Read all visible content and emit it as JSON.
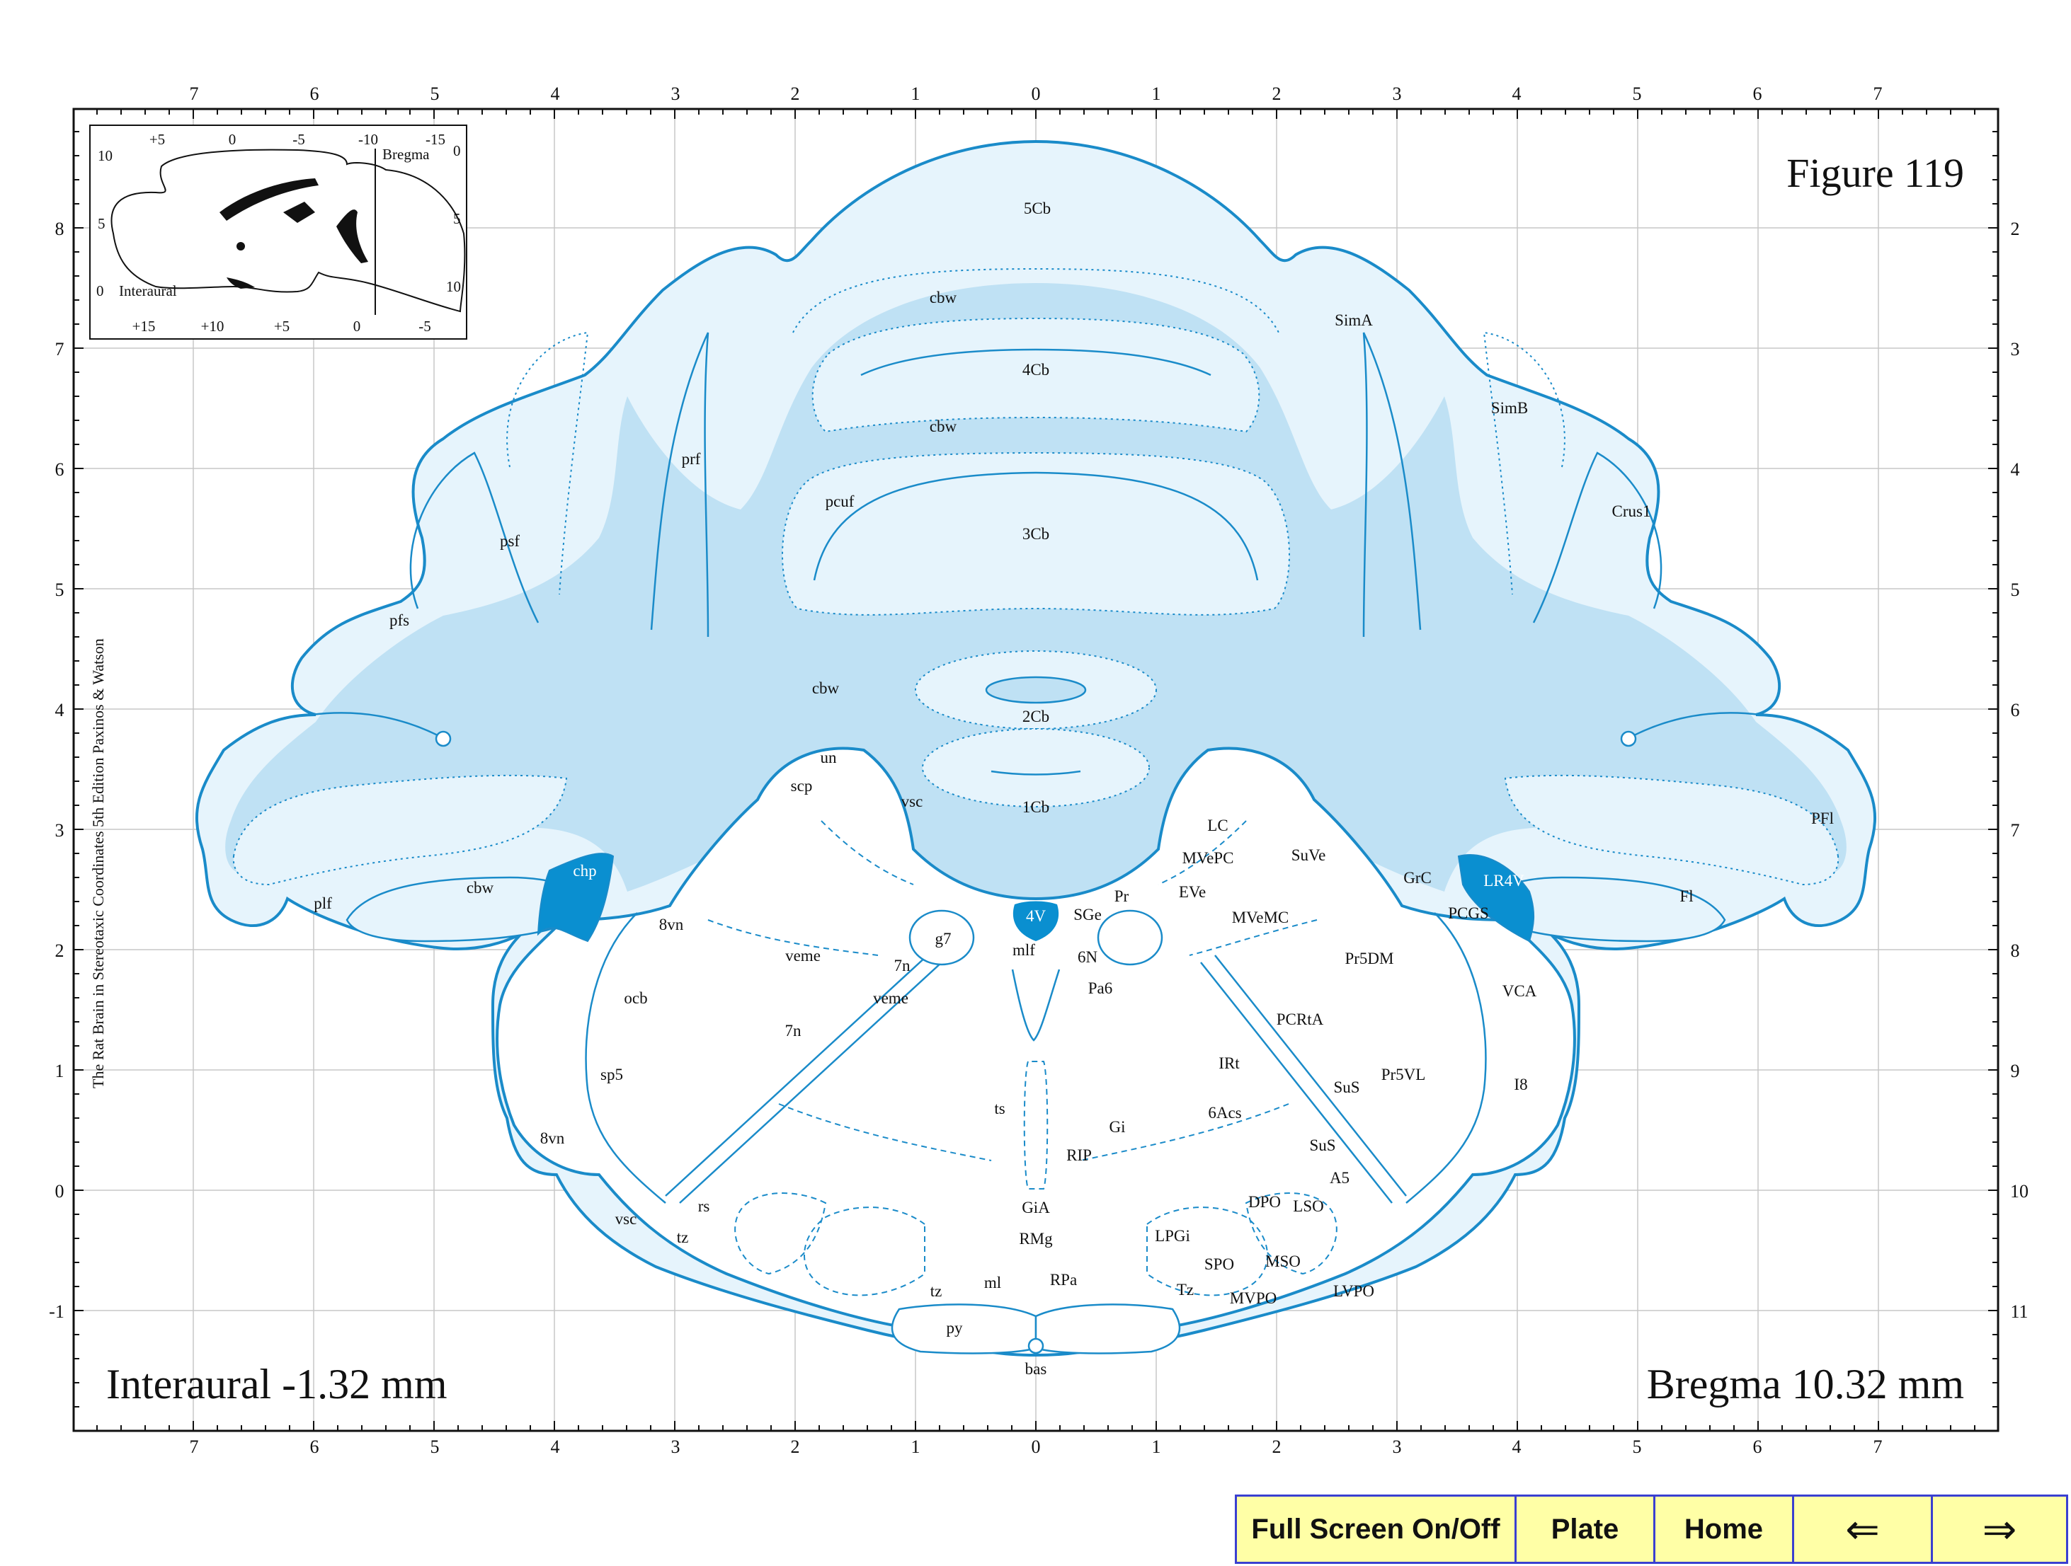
{
  "figure": {
    "title": "Figure 119",
    "interaural_caption": "Interaural -1.32 mm",
    "bregma_caption": "Bregma 10.32 mm",
    "credit": "The Rat Brain in Stereotaxic Coordinates  5th Edition  Paxinos & Watson"
  },
  "axes": {
    "top_ticks": [
      "7",
      "6",
      "5",
      "4",
      "3",
      "2",
      "1",
      "0",
      "1",
      "2",
      "3",
      "4",
      "5",
      "6",
      "7"
    ],
    "bottom_ticks": [
      "7",
      "6",
      "5",
      "4",
      "3",
      "2",
      "1",
      "0",
      "1",
      "2",
      "3",
      "4",
      "5",
      "6",
      "7"
    ],
    "left_ticks": [
      "8",
      "7",
      "6",
      "5",
      "4",
      "3",
      "2",
      "1",
      "0",
      "-1"
    ],
    "right_ticks": [
      "2",
      "3",
      "4",
      "5",
      "6",
      "7",
      "8",
      "9",
      "10",
      "11"
    ]
  },
  "inset": {
    "top_ticks": [
      "+5",
      "0",
      "-5",
      "-10",
      "-15"
    ],
    "bottom_ticks": [
      "+15",
      "+10",
      "+5",
      "0",
      "-5"
    ],
    "left_ticks": [
      "10",
      "5",
      "0"
    ],
    "right_ticks": [
      "0",
      "5",
      "10"
    ],
    "bregma_label": "Bregma",
    "interaural_label": "Interaural"
  },
  "structures": {
    "c5Cb": "5Cb",
    "cbw_top1": "cbw",
    "c4Cb": "4Cb",
    "cbw_top2": "cbw",
    "c3Cb": "3Cb",
    "c2Cb": "2Cb",
    "c1Cb": "1Cb",
    "cbw_center": "cbw",
    "cbw_left": "cbw",
    "prf": "prf",
    "pcuf": "pcuf",
    "psf": "psf",
    "pfs": "pfs",
    "plf": "plf",
    "SimA": "SimA",
    "SimB": "SimB",
    "Crus1": "Crus1",
    "PFl": "PFl",
    "Fl": "Fl",
    "chp": "chp",
    "LR4V": "LR4V",
    "GrC": "GrC",
    "PCGS": "PCGS",
    "un": "un",
    "scp": "scp",
    "vsc_top": "vsc",
    "LC": "LC",
    "MVePC": "MVePC",
    "SuVe": "SuVe",
    "EVe": "EVe",
    "MVeMC": "MVeMC",
    "Pr": "Pr",
    "SGe": "SGe",
    "v4V": "4V",
    "mlf": "mlf",
    "n6N": "6N",
    "Pa6": "Pa6",
    "g7": "g7",
    "n7n_top": "7n",
    "veme_l": "veme",
    "veme_c": "veme",
    "n8vn_top": "8vn",
    "ocb": "ocb",
    "n7n_mid": "7n",
    "sp5": "sp5",
    "n8vn_low": "8vn",
    "ts": "ts",
    "Gi": "Gi",
    "RIP": "RIP",
    "IRt": "IRt",
    "n6Acs": "6Acs",
    "SuS1": "SuS",
    "SuS2": "SuS",
    "Pr5DM": "Pr5DM",
    "PCRtA": "PCRtA",
    "Pr5VL": "Pr5VL",
    "VCA": "VCA",
    "I8": "I8",
    "A5": "A5",
    "DPO": "DPO",
    "LSO": "LSO",
    "GiA": "GiA",
    "RMg": "RMg",
    "LPGi": "LPGi",
    "SPO": "SPO",
    "MSO": "MSO",
    "LVPO": "LVPO",
    "MVPO": "MVPO",
    "Tz": "Tz",
    "RPa": "RPa",
    "ml": "ml",
    "tz_l": "tz",
    "tz_c": "tz",
    "py": "py",
    "bas": "bas",
    "rs": "rs",
    "vsc_low": "vsc"
  },
  "nav": {
    "fullscreen": "Full Screen On/Off",
    "plate": "Plate",
    "home": "Home",
    "prev": "⇐",
    "next": "⇒"
  },
  "colors": {
    "outline": "#1a8bc9",
    "white_matter": "#bfe1f4",
    "gray_matter": "#e6f4fc",
    "ventricle": "#0a8fd0",
    "nav_bg": "#ffffa6",
    "nav_border": "#3a3fd0"
  }
}
